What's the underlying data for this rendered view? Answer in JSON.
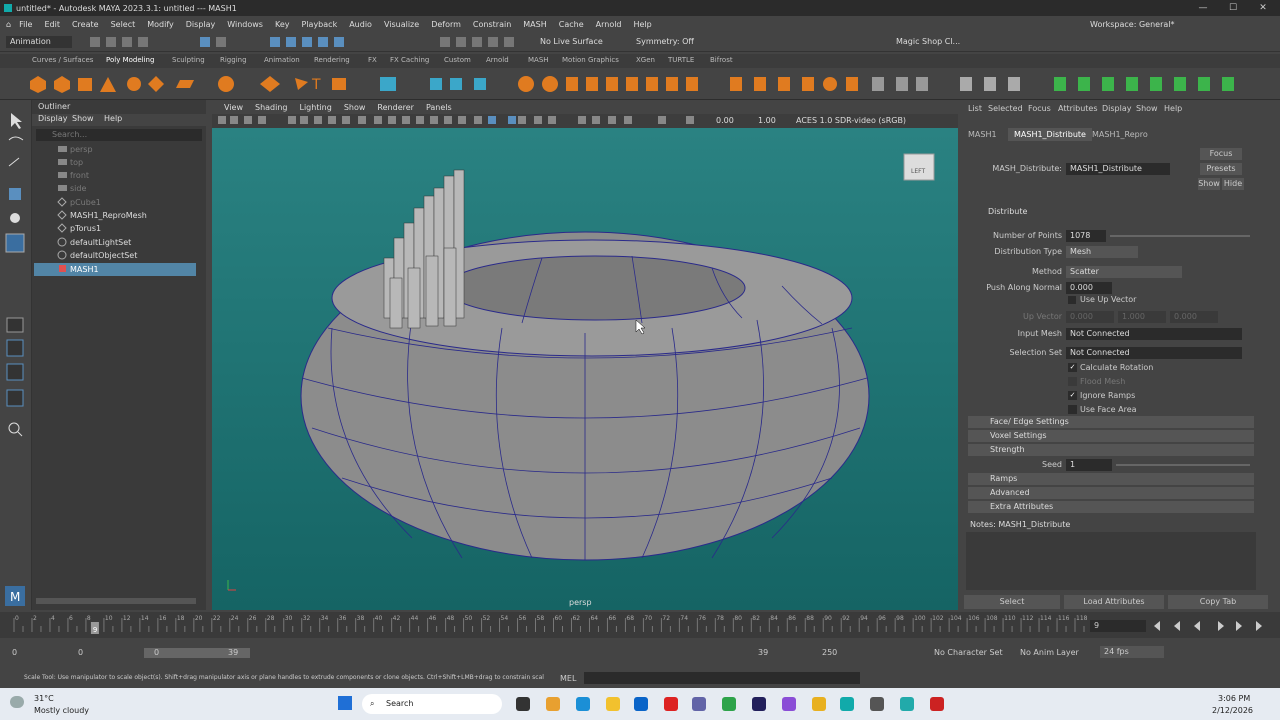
{
  "window": {
    "title": "untitled* - Autodesk MAYA 2023.3.1: untitled   ---   MASH1",
    "min": "—",
    "max": "☐",
    "close": "✕"
  },
  "menubar": {
    "items": [
      "File",
      "Edit",
      "Create",
      "Select",
      "Modify",
      "Display",
      "Windows",
      "Key",
      "Playback",
      "Audio",
      "Visualize",
      "Deform",
      "Constrain",
      "MASH",
      "Cache",
      "Arnold",
      "Help"
    ],
    "workspace": "Workspace: General*"
  },
  "statusline": {
    "mode": "Animation",
    "live_surface": "No Live Surface",
    "symmetry": "Symmetry: Off",
    "magic_shop": "Magic Shop Cl..."
  },
  "shelf_tabs": [
    "Curves / Surfaces",
    "Poly Modeling",
    "Sculpting",
    "Rigging",
    "Animation",
    "Rendering",
    "FX",
    "FX Caching",
    "Custom",
    "Arnold",
    "MASH",
    "Motion Graphics",
    "XGen",
    "TURTLE",
    "Bifrost"
  ],
  "outliner": {
    "title": "Outliner",
    "menu": [
      "Display",
      "Show",
      "Help"
    ],
    "search_placeholder": "Search...",
    "items": [
      {
        "label": "persp",
        "dim": true
      },
      {
        "label": "top",
        "dim": true
      },
      {
        "label": "front",
        "dim": true
      },
      {
        "label": "side",
        "dim": true
      },
      {
        "label": "pCube1",
        "dim": true
      },
      {
        "label": "MASH1_ReproMesh",
        "dim": false
      },
      {
        "label": "pTorus1",
        "dim": false
      },
      {
        "label": "defaultLightSet",
        "dim": false
      },
      {
        "label": "defaultObjectSet",
        "dim": false
      },
      {
        "label": "MASH1",
        "dim": false,
        "selected": true
      }
    ]
  },
  "viewport": {
    "menu": [
      "View",
      "Shading",
      "Lighting",
      "Show",
      "Renderer",
      "Panels"
    ],
    "exposure": "0.00",
    "gamma": "1.00",
    "colorspace": "ACES 1.0 SDR-video (sRGB)",
    "camera_label": "persp",
    "cube_label": "LEFT"
  },
  "attr_editor": {
    "menu": [
      "List",
      "Selected",
      "Focus",
      "Attributes",
      "Display",
      "Show",
      "Help"
    ],
    "tabs": [
      "MASH1",
      "MASH1_Distribute",
      "MASH1_Repro"
    ],
    "node_label": "MASH_Distribute:",
    "node_value": "MASH1_Distribute",
    "focus": "Focus",
    "presets": "Presets",
    "show": "Show",
    "hide": "Hide",
    "section": "Distribute",
    "num_points_label": "Number of Points",
    "num_points": "1078",
    "dist_type_label": "Distribution Type",
    "dist_type": "Mesh",
    "method_label": "Method",
    "method": "Scatter",
    "push_label": "Push Along Normal",
    "push": "0.000",
    "use_up_vector": "Use Up Vector",
    "up_vector_label": "Up Vector",
    "up_vector": [
      "0.000",
      "1.000",
      "0.000"
    ],
    "input_mesh_label": "Input Mesh",
    "input_mesh": "Not Connected",
    "selection_set_label": "Selection Set",
    "selection_set": "Not Connected",
    "calc_rotation": "Calculate Rotation",
    "flood_mesh": "Flood Mesh",
    "ignore_ramps": "Ignore Ramps",
    "use_face_area": "Use Face Area",
    "seed_label": "Seed",
    "seed": "1",
    "sections": [
      "Face/ Edge Settings",
      "Voxel Settings",
      "Strength"
    ],
    "sections2": [
      "Ramps",
      "Advanced",
      "Extra Attributes"
    ],
    "notes": "Notes:  MASH1_Distribute",
    "btn_select": "Select",
    "btn_load": "Load Attributes",
    "btn_copy": "Copy Tab"
  },
  "timeline": {
    "ticks": [
      "0",
      "2",
      "4",
      "6",
      "8",
      "10",
      "12",
      "14",
      "16",
      "18",
      "20",
      "22",
      "24",
      "26",
      "28",
      "30",
      "32",
      "34",
      "36",
      "38",
      "40",
      "42",
      "44",
      "46",
      "48",
      "50",
      "52",
      "54",
      "56",
      "58",
      "60",
      "62",
      "64",
      "66",
      "68",
      "70",
      "72",
      "74",
      "76",
      "78",
      "80",
      "82",
      "84",
      "86",
      "88",
      "90",
      "92",
      "94",
      "96",
      "98",
      "100",
      "102",
      "104",
      "106",
      "108",
      "110",
      "112",
      "114",
      "116",
      "118"
    ],
    "current": "9",
    "current_field": "9"
  },
  "range": {
    "start": "0",
    "anim_start": "0",
    "slider_start": "0",
    "slider_end": "39",
    "end": "39",
    "anim_end": "250",
    "char_set": "No Character Set",
    "anim_layer": "No Anim Layer",
    "fps": "24 fps"
  },
  "cmdline": {
    "help": "Scale Tool: Use manipulator to scale object(s). Shift+drag manipulator axis or plane handles to extrude components or clone objects. Ctrl+Shift+LMB+drag to constrain scaling to",
    "lang": "MEL"
  },
  "taskbar": {
    "temp": "31°C",
    "weather": "Mostly cloudy",
    "search": "Search",
    "time": "3:06 PM",
    "date": "2/12/2026"
  }
}
